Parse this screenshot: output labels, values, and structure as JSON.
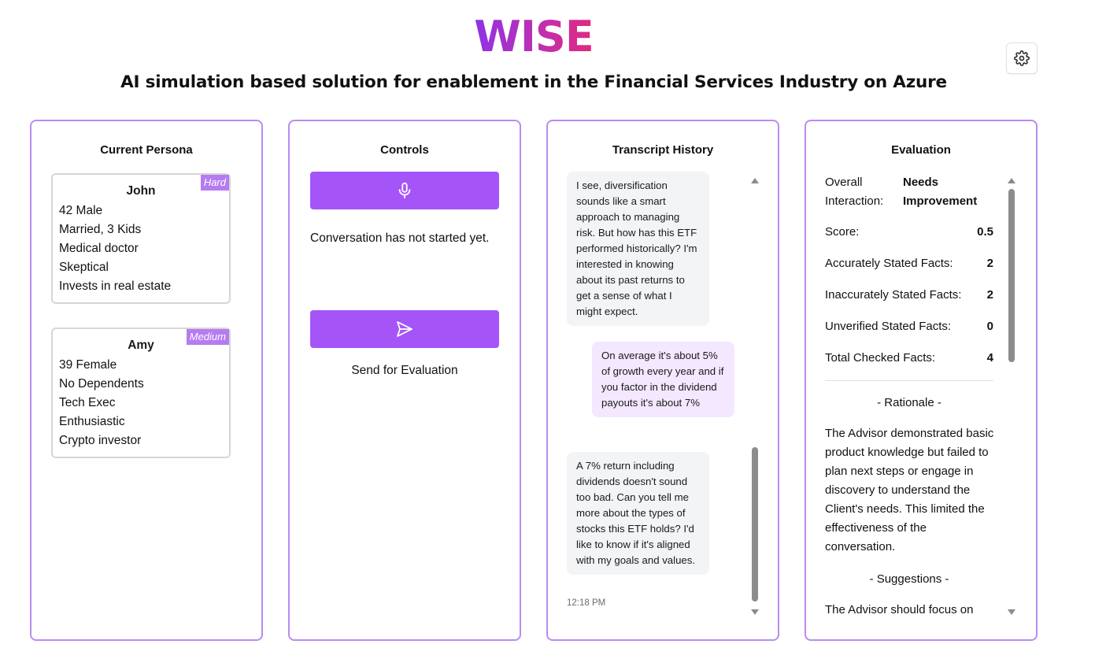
{
  "header": {
    "logo": "WISE",
    "subtitle": "AI simulation based solution for enablement in the Financial Services Industry on Azure"
  },
  "settings_icon": "gear-icon",
  "persona_panel": {
    "title": "Current Persona",
    "personas": [
      {
        "name": "John",
        "difficulty": "Hard",
        "lines": [
          "42 Male",
          "Married, 3 Kids",
          "Medical doctor",
          "Skeptical",
          "Invests in real estate"
        ]
      },
      {
        "name": "Amy",
        "difficulty": "Medium",
        "lines": [
          "39 Female",
          "No Dependents",
          "Tech Exec",
          "Enthusiastic",
          "Crypto investor"
        ]
      }
    ]
  },
  "controls_panel": {
    "title": "Controls",
    "mic_icon": "microphone-icon",
    "status": "Conversation has not started yet.",
    "send_icon": "send-icon",
    "send_label": "Send for Evaluation"
  },
  "transcript_panel": {
    "title": "Transcript History",
    "messages": [
      {
        "role": "client",
        "text": "I see, diversification sounds like a smart approach to managing risk. But how has this ETF performed historically? I'm interested in knowing about its past returns to get a sense of what I might expect."
      },
      {
        "role": "advisor",
        "text": "On average it's about 5% of growth every year and if you factor in the dividend payouts it's about 7%"
      },
      {
        "role": "client",
        "text": "A 7% return including dividends doesn't sound too bad. Can you tell me more about the types of stocks this ETF holds? I'd like to know if it's aligned with my goals and values."
      }
    ],
    "timestamp": "12:18 PM"
  },
  "evaluation_panel": {
    "title": "Evaluation",
    "overall_label": "Overall Interaction:",
    "overall_value": "Needs Improvement",
    "metrics": [
      {
        "label": "Score:",
        "value": "0.5"
      },
      {
        "label": "Accurately Stated Facts:",
        "value": "2"
      },
      {
        "label": "Inaccurately Stated Facts:",
        "value": "2"
      },
      {
        "label": "Unverified Stated Facts:",
        "value": "0"
      },
      {
        "label": "Total Checked Facts:",
        "value": "4"
      }
    ],
    "rationale_heading": "- Rationale -",
    "rationale_text": "The Advisor demonstrated basic product knowledge but failed to plan next steps or engage in discovery to understand the Client's needs. This limited the effectiveness of the conversation.",
    "suggestions_heading": "- Suggestions -",
    "suggestions_text": "The Advisor should focus on"
  },
  "colors": {
    "accent": "#a555f7",
    "panel_border": "#b98cf0",
    "badge": "#b57cf0",
    "advisor_bubble": "#f3e8ff",
    "client_bubble": "#f3f4f6"
  }
}
